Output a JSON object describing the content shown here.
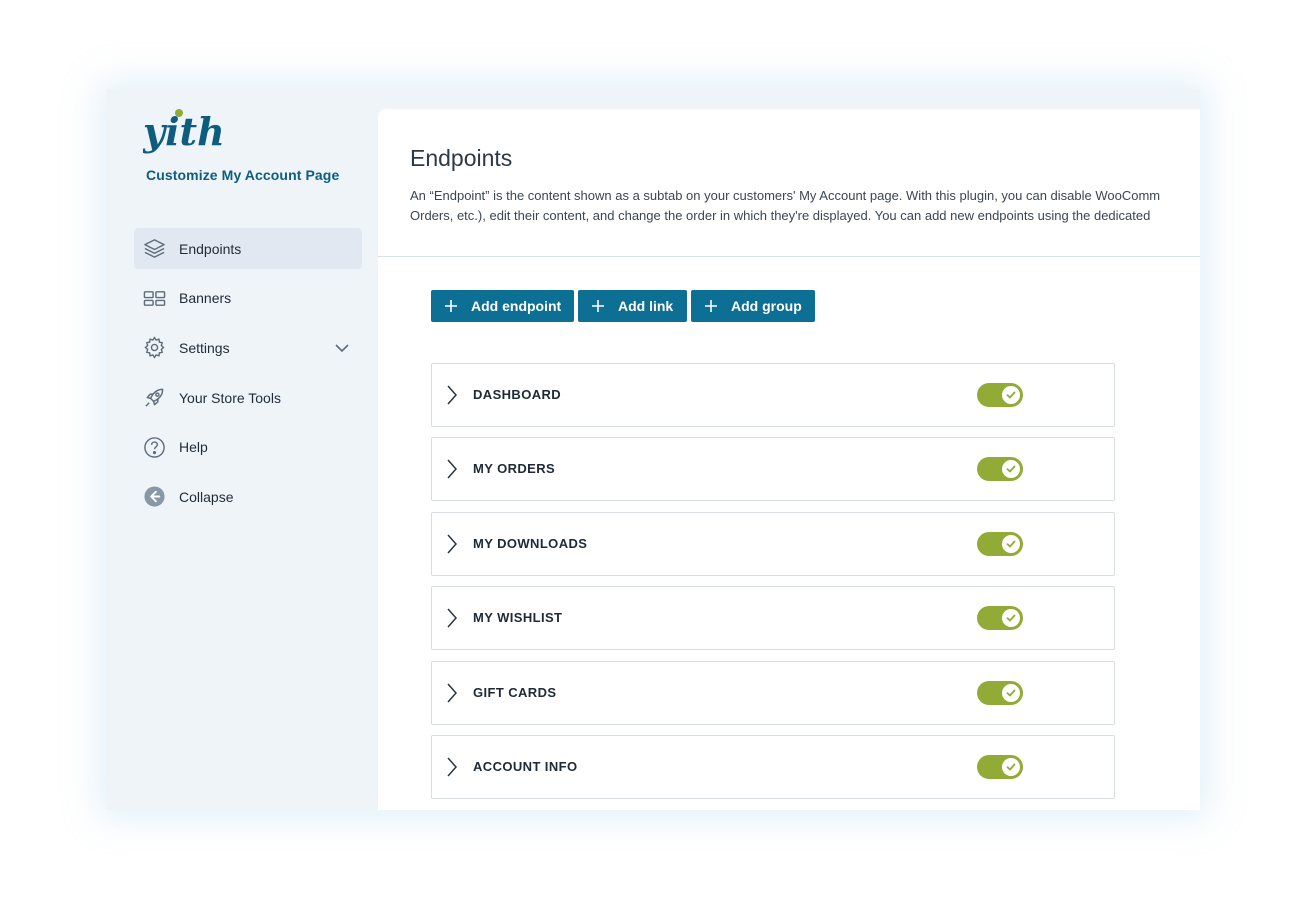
{
  "brand": {
    "logo_text": "yith",
    "app_title": "Customize My Account Page",
    "accent": "#0d6f94",
    "toggle_color": "#91ab36"
  },
  "sidebar": {
    "items": [
      {
        "label": "Endpoints",
        "icon": "layers-icon",
        "active": true
      },
      {
        "label": "Banners",
        "icon": "banners-icon"
      },
      {
        "label": "Settings",
        "icon": "gear-icon",
        "has_chevron": true
      },
      {
        "label": "Your Store Tools",
        "icon": "rocket-icon"
      },
      {
        "label": "Help",
        "icon": "help-icon"
      },
      {
        "label": "Collapse",
        "icon": "collapse-icon"
      }
    ]
  },
  "main": {
    "title": "Endpoints",
    "description": [
      "An “Endpoint” is the content shown as a subtab on your customers' My Account page. With this plugin, you can disable WooComm",
      "Orders, etc.), edit their content, and change the order in which they're displayed. You can add new endpoints using the dedicated"
    ],
    "buttons": {
      "add_endpoint": "Add endpoint",
      "add_link": "Add link",
      "add_group": "Add group"
    },
    "endpoints": [
      {
        "label": "DASHBOARD",
        "enabled": true
      },
      {
        "label": "MY ORDERS",
        "enabled": true
      },
      {
        "label": "MY DOWNLOADS",
        "enabled": true
      },
      {
        "label": "MY WISHLIST",
        "enabled": true
      },
      {
        "label": "GIFT CARDS",
        "enabled": true
      },
      {
        "label": "ACCOUNT INFO",
        "enabled": true
      }
    ]
  }
}
